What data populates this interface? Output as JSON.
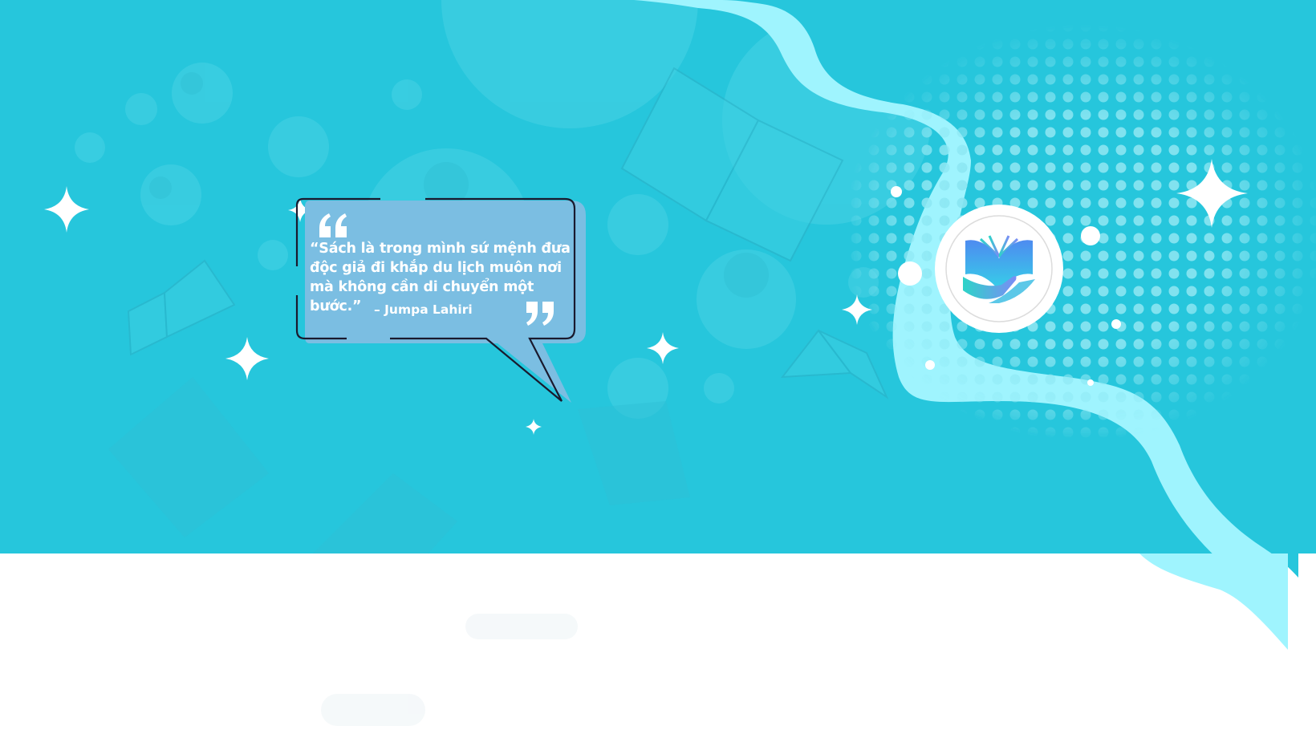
{
  "banner": {
    "colors": {
      "background": "#26c6dc",
      "wave": "#9ff4fe",
      "bubble_fill": "#7bbee2",
      "bubble_outline": "#1a1a2e",
      "dots": "#7fe3f0",
      "sparkle": "#ffffff",
      "footer": "#ffffff"
    },
    "decorations": [
      "book-icon",
      "sparkle-icon",
      "bubble-shapes",
      "halftone-dots"
    ]
  },
  "quote": {
    "text": "“Sách là trong mình sứ mệnh đưa độc giả đi khắp du lịch muôn nơi mà không cần di chuyển một bước.”",
    "author": "– Jumpa Lahiri",
    "open_mark_icon": "quote-open-icon",
    "close_mark_icon": "quote-close-icon"
  },
  "logo": {
    "icon": "book-hands-logo-icon"
  }
}
